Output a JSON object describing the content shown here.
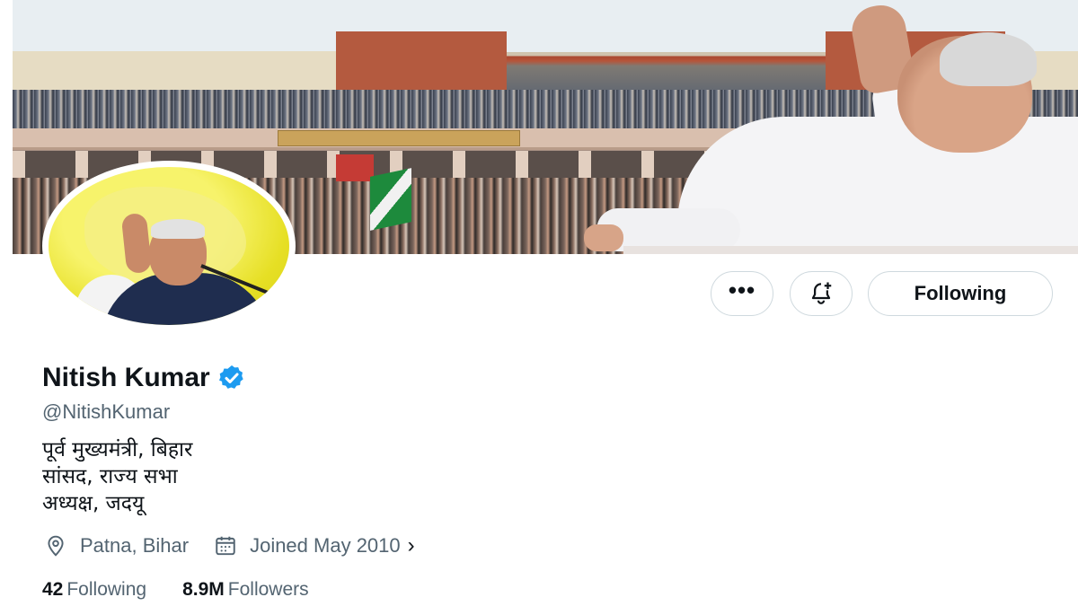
{
  "profile": {
    "name": "Nitish Kumar",
    "handle": "@NitishKumar",
    "bio": [
      "पूर्व मुख्यमंत्री, बिहार",
      "सांसद, राज्य सभा",
      "अध्यक्ष, जदयू"
    ],
    "location": "Patna, Bihar",
    "joined": "Joined May 2010",
    "following_count": "42",
    "following_label": "Following",
    "followers_count": "8.9M",
    "followers_label": "Followers"
  },
  "actions": {
    "more_label": "•••",
    "follow_button_label": "Following"
  },
  "icons": {
    "verified": "verified-badge-icon",
    "more": "more-icon",
    "notify": "bell-plus-icon",
    "location": "location-pin-icon",
    "calendar": "calendar-icon",
    "chevron": "chevron-right-icon"
  },
  "colors": {
    "verified_blue": "#1d9bf0",
    "text_primary": "#0f1419",
    "text_secondary": "#536471",
    "border": "#cfd9de",
    "avatar_bg": "#e6df24"
  }
}
